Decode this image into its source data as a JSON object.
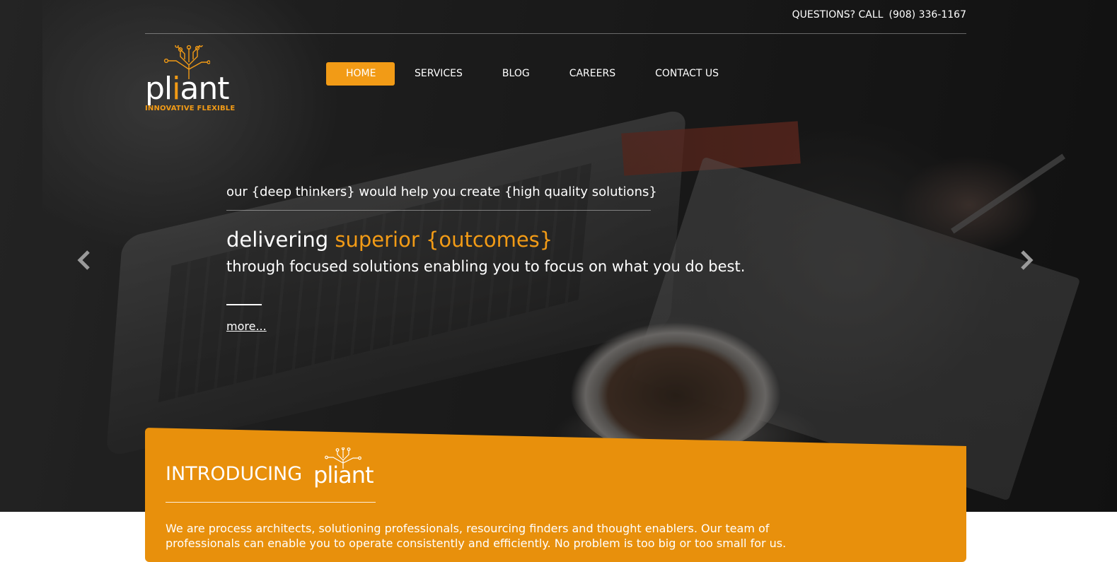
{
  "colors": {
    "accent": "#f29b16",
    "intro_bg": "#e8900c",
    "text": "#ffffff"
  },
  "topbar": {
    "questions_label": "QUESTIONS? CALL",
    "phone_number": "(908) 336-1167"
  },
  "logo": {
    "word_start": "pl",
    "word_i": "i",
    "word_end": "ant",
    "tagline": "INNOVATIVE FLEXIBLE",
    "icon": "circuit-tree-icon"
  },
  "nav": {
    "items": [
      {
        "label": "HOME",
        "active": true
      },
      {
        "label": "SERVICES"
      },
      {
        "label": "BLOG"
      },
      {
        "label": "CAREERS"
      },
      {
        "label": "CONTACT US"
      }
    ]
  },
  "carousel": {
    "prev_icon": "chevron-left-icon",
    "next_icon": "chevron-right-icon"
  },
  "slide": {
    "kicker": "our {deep thinkers} would help you create {high quality solutions}",
    "headline_plain": "delivering ",
    "headline_highlight": "superior {outcomes}",
    "subline": "through focused solutions enabling you to focus on what you do best.",
    "more": "more..."
  },
  "intro": {
    "title": "INTRODUCING",
    "logo_word": "pliant",
    "text": "We are process architects, solutioning professionals, resourcing finders and thought enablers. Our team of professionals can enable you to operate consistently and efficiently. No problem is too big or too small for us."
  }
}
